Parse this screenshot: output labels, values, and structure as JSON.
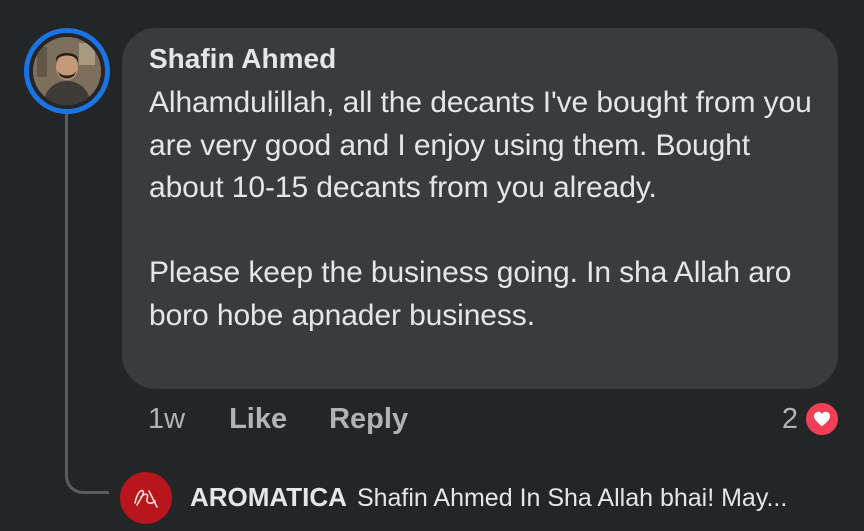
{
  "comment": {
    "author": "Shafin Ahmed",
    "paragraphs": [
      "Alhamdulillah, all the decants I've bought from you are very good and I enjoy using them. Bought about 10-15 decants from you already.",
      "Please keep the business going. In sha Allah aro boro hobe apnader business."
    ],
    "time": "1w",
    "like_label": "Like",
    "reply_label": "Reply",
    "reaction_count": "2",
    "reaction_type": "heart-icon"
  },
  "reply": {
    "author": "AROMATICA",
    "preview": "Shafin Ahmed In Sha Allah bhai! May..."
  },
  "colors": {
    "background": "#242526",
    "bubble": "#3a3b3c",
    "avatar_ring": "#1b74e4",
    "heart": "#f33e58",
    "brand": "#b8161c"
  }
}
